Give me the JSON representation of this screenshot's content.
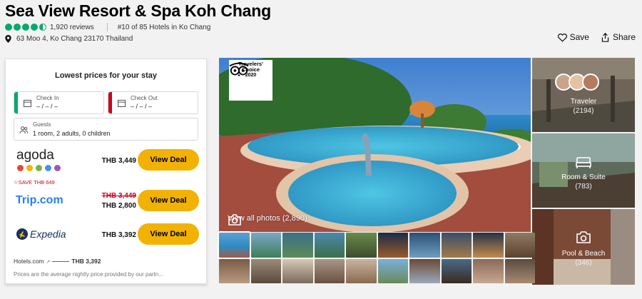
{
  "hotel": {
    "name": "Sea View Resort & Spa Koh Chang",
    "reviews": "1,920 reviews",
    "rank": "#10 of 85 Hotels in Ko Chang",
    "address": "63 Moo 4, Ko Chang 23170 Thailand",
    "rating_bubbles": 4.5
  },
  "actions": {
    "save": "Save",
    "share": "Share"
  },
  "prices_panel": {
    "title": "Lowest prices for your stay",
    "check_in_label": "Check In",
    "check_in_value": "– / – / –",
    "check_out_label": "Check Out",
    "check_out_value": "– / – / –",
    "guests_label": "Guests",
    "guests_value": "1 room, 2 adults, 0 children",
    "deals": [
      {
        "provider": "agoda",
        "price": "THB 3,449",
        "button": "View Deal"
      },
      {
        "provider": "Trip.com",
        "badge": "SAVE THB 649",
        "old_price": "THB 3,449",
        "price": "THB 2,800",
        "button": "View Deal"
      },
      {
        "provider": "Expedia",
        "price": "THB 3,392",
        "button": "View Deal"
      }
    ],
    "hotelscom_name": "Hotels.com",
    "hotelscom_price": "THB 3,392",
    "footnote": "Prices are the average nightly price provided by our partn..."
  },
  "gallery": {
    "badge_line1": "Travelers'",
    "badge_line2": "Choice",
    "badge_year": "2020",
    "view_all": "View all photos",
    "view_all_count": "(2,890)",
    "side": [
      {
        "label": "Traveler",
        "count": "(2194)"
      },
      {
        "label": "Room & Suite",
        "count": "(783)"
      },
      {
        "label": "Pool & Beach",
        "count": "(346)"
      }
    ]
  },
  "colors": {
    "accent": "#00aa6c",
    "button": "#f2b203",
    "checkin_bar": "#00aa6c",
    "checkout_bar": "#d0021b"
  }
}
